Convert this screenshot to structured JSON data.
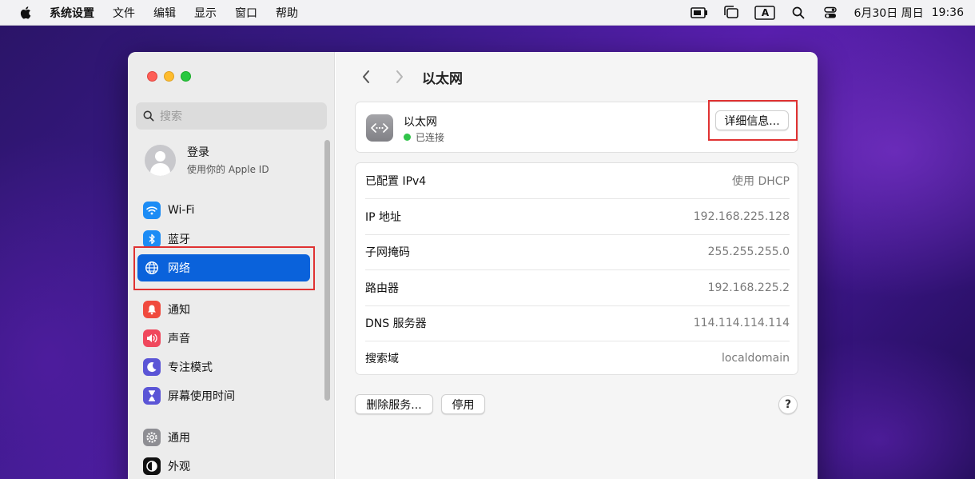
{
  "menubar": {
    "app_name": "系统设置",
    "menus": [
      "文件",
      "编辑",
      "显示",
      "窗口",
      "帮助"
    ],
    "status": {
      "input_source": "A",
      "date": "6月30日 周日",
      "time": "19:36"
    }
  },
  "sidebar": {
    "search_placeholder": "搜索",
    "account": {
      "title": "登录",
      "subtitle": "使用你的 Apple ID"
    },
    "items": [
      {
        "label": "Wi-Fi",
        "icon": "wifi-icon",
        "color": "#1c8cf5"
      },
      {
        "label": "蓝牙",
        "icon": "bluetooth-icon",
        "color": "#1c8cf5"
      },
      {
        "label": "网络",
        "icon": "globe-icon",
        "color": "#1c8cf5",
        "selected": true
      },
      {
        "label": "通知",
        "icon": "bell-icon",
        "color": "#f04a3e"
      },
      {
        "label": "声音",
        "icon": "speaker-icon",
        "color": "#f0485d"
      },
      {
        "label": "专注模式",
        "icon": "moon-icon",
        "color": "#5b55d6"
      },
      {
        "label": "屏幕使用时间",
        "icon": "hourglass-icon",
        "color": "#5b55d6"
      },
      {
        "label": "通用",
        "icon": "gear-icon",
        "color": "#8e8e93"
      },
      {
        "label": "外观",
        "icon": "appearance-icon",
        "color": "#111111"
      }
    ]
  },
  "main": {
    "title": "以太网",
    "service": {
      "name": "以太网",
      "status": "已连接",
      "details_button": "详细信息..."
    },
    "info_rows": [
      {
        "label": "已配置 IPv4",
        "value": "使用 DHCP"
      },
      {
        "label": "IP 地址",
        "value": "192.168.225.128"
      },
      {
        "label": "子网掩码",
        "value": "255.255.255.0"
      },
      {
        "label": "路由器",
        "value": "192.168.225.2"
      },
      {
        "label": "DNS 服务器",
        "value": "114.114.114.114"
      },
      {
        "label": "搜索域",
        "value": "localdomain"
      }
    ],
    "delete_button": "删除服务...",
    "disable_button": "停用",
    "help_button": "?"
  }
}
